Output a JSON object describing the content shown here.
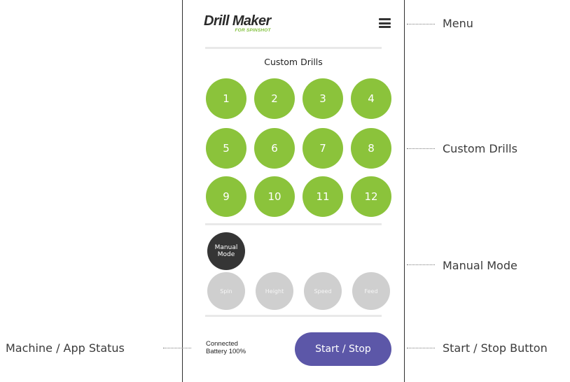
{
  "app": {
    "logo_main": "Drill Maker",
    "logo_sub": "FOR SPINSHOT"
  },
  "custom_drills": {
    "title": "Custom Drills",
    "items": [
      "1",
      "2",
      "3",
      "4",
      "5",
      "6",
      "7",
      "8",
      "9",
      "10",
      "11",
      "12"
    ]
  },
  "manual": {
    "button_line1": "Manual",
    "button_line2": "Mode",
    "controls": [
      "Spin",
      "Height",
      "Speed",
      "Feed"
    ]
  },
  "status": {
    "connection": "Connected",
    "battery": "Battery 100%"
  },
  "start_stop_label": "Start / Stop",
  "callouts": {
    "menu": "Menu",
    "custom_drills": "Custom Drills",
    "manual_mode": "Manual Mode",
    "start_stop": "Start / Stop Button",
    "status": "Machine / App Status"
  },
  "colors": {
    "drill_green": "#8bc33b",
    "start_purple": "#5c57a8",
    "manual_dark": "#353535",
    "control_gray": "#cfcfcf",
    "logo_green": "#7fbf3a"
  },
  "icons": {
    "menu": "hamburger-menu-icon"
  }
}
